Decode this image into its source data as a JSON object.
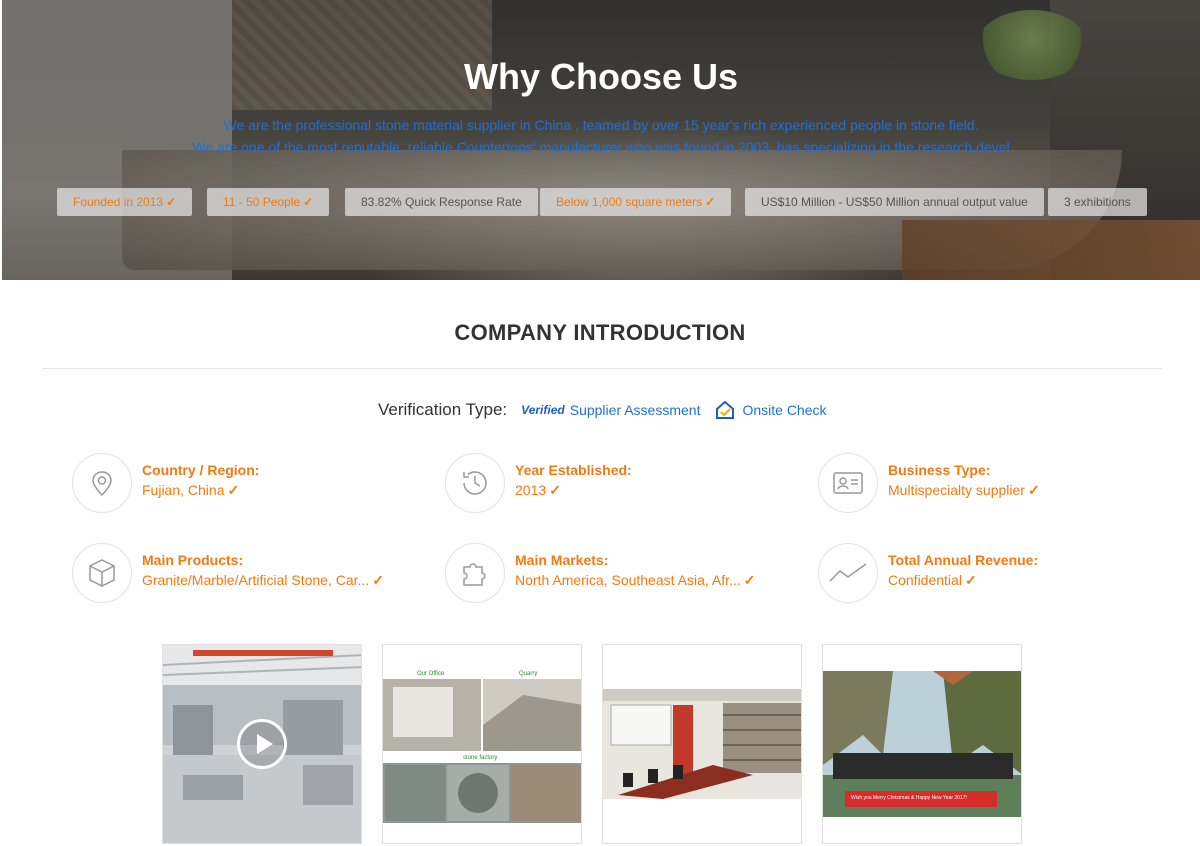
{
  "hero": {
    "title": "Why Choose Us",
    "line1": "We are the professional stone material supplier in China , teamed by over 15 year's rich experienced people in stone field.",
    "line2": "We are one of the most reputable, reliable Countertops' manufacturer who was found in 2003 ,has specializing in the research,devel",
    "badges": [
      {
        "text": "Founded in 2013",
        "checked": true,
        "style": "orange"
      },
      {
        "text": "11 - 50 People",
        "checked": true,
        "style": "orange"
      },
      {
        "text": "83.82% Quick Response Rate",
        "checked": false,
        "style": "gray"
      },
      {
        "text": "Below 1,000 square meters",
        "checked": true,
        "style": "orange"
      },
      {
        "text": "US$10 Million - US$50 Million annual output value",
        "checked": false,
        "style": "gray"
      },
      {
        "text": "3 exhibitions",
        "checked": false,
        "style": "gray"
      }
    ]
  },
  "intro": {
    "title": "COMPANY INTRODUCTION",
    "verification_label": "Verification Type:",
    "verified_logo": "Verified",
    "supplier_assessment": "Supplier Assessment",
    "onsite_check": "Onsite Check",
    "check_mark": "✓",
    "facts": [
      {
        "label": "Country / Region:",
        "value": "Fujian, China",
        "icon": "location-pin-icon"
      },
      {
        "label": "Year Established:",
        "value": "2013",
        "icon": "clock-history-icon"
      },
      {
        "label": "Business Type:",
        "value": "Multispecialty supplier",
        "icon": "id-card-icon"
      },
      {
        "label": "Main Products:",
        "value": "Granite/Marble/Artificial Stone, Car...",
        "icon": "box-icon"
      },
      {
        "label": "Main Markets:",
        "value": "North America, Southeast Asia, Afr...",
        "icon": "puzzle-icon"
      },
      {
        "label": "Total Annual Revenue:",
        "value": "Confidential",
        "icon": "line-chart-icon"
      }
    ]
  },
  "gallery": {
    "photo2": {
      "our_office": "Our Office",
      "quarry": "Quarry",
      "stone_factory": "stone factory"
    },
    "photo4": {
      "banner": "Wish you Merry Christmas & Happy New Year 2017!"
    }
  },
  "colors": {
    "accent": "#f07b13",
    "link": "#1f73c8",
    "hero_text": "#1e6fd9"
  }
}
